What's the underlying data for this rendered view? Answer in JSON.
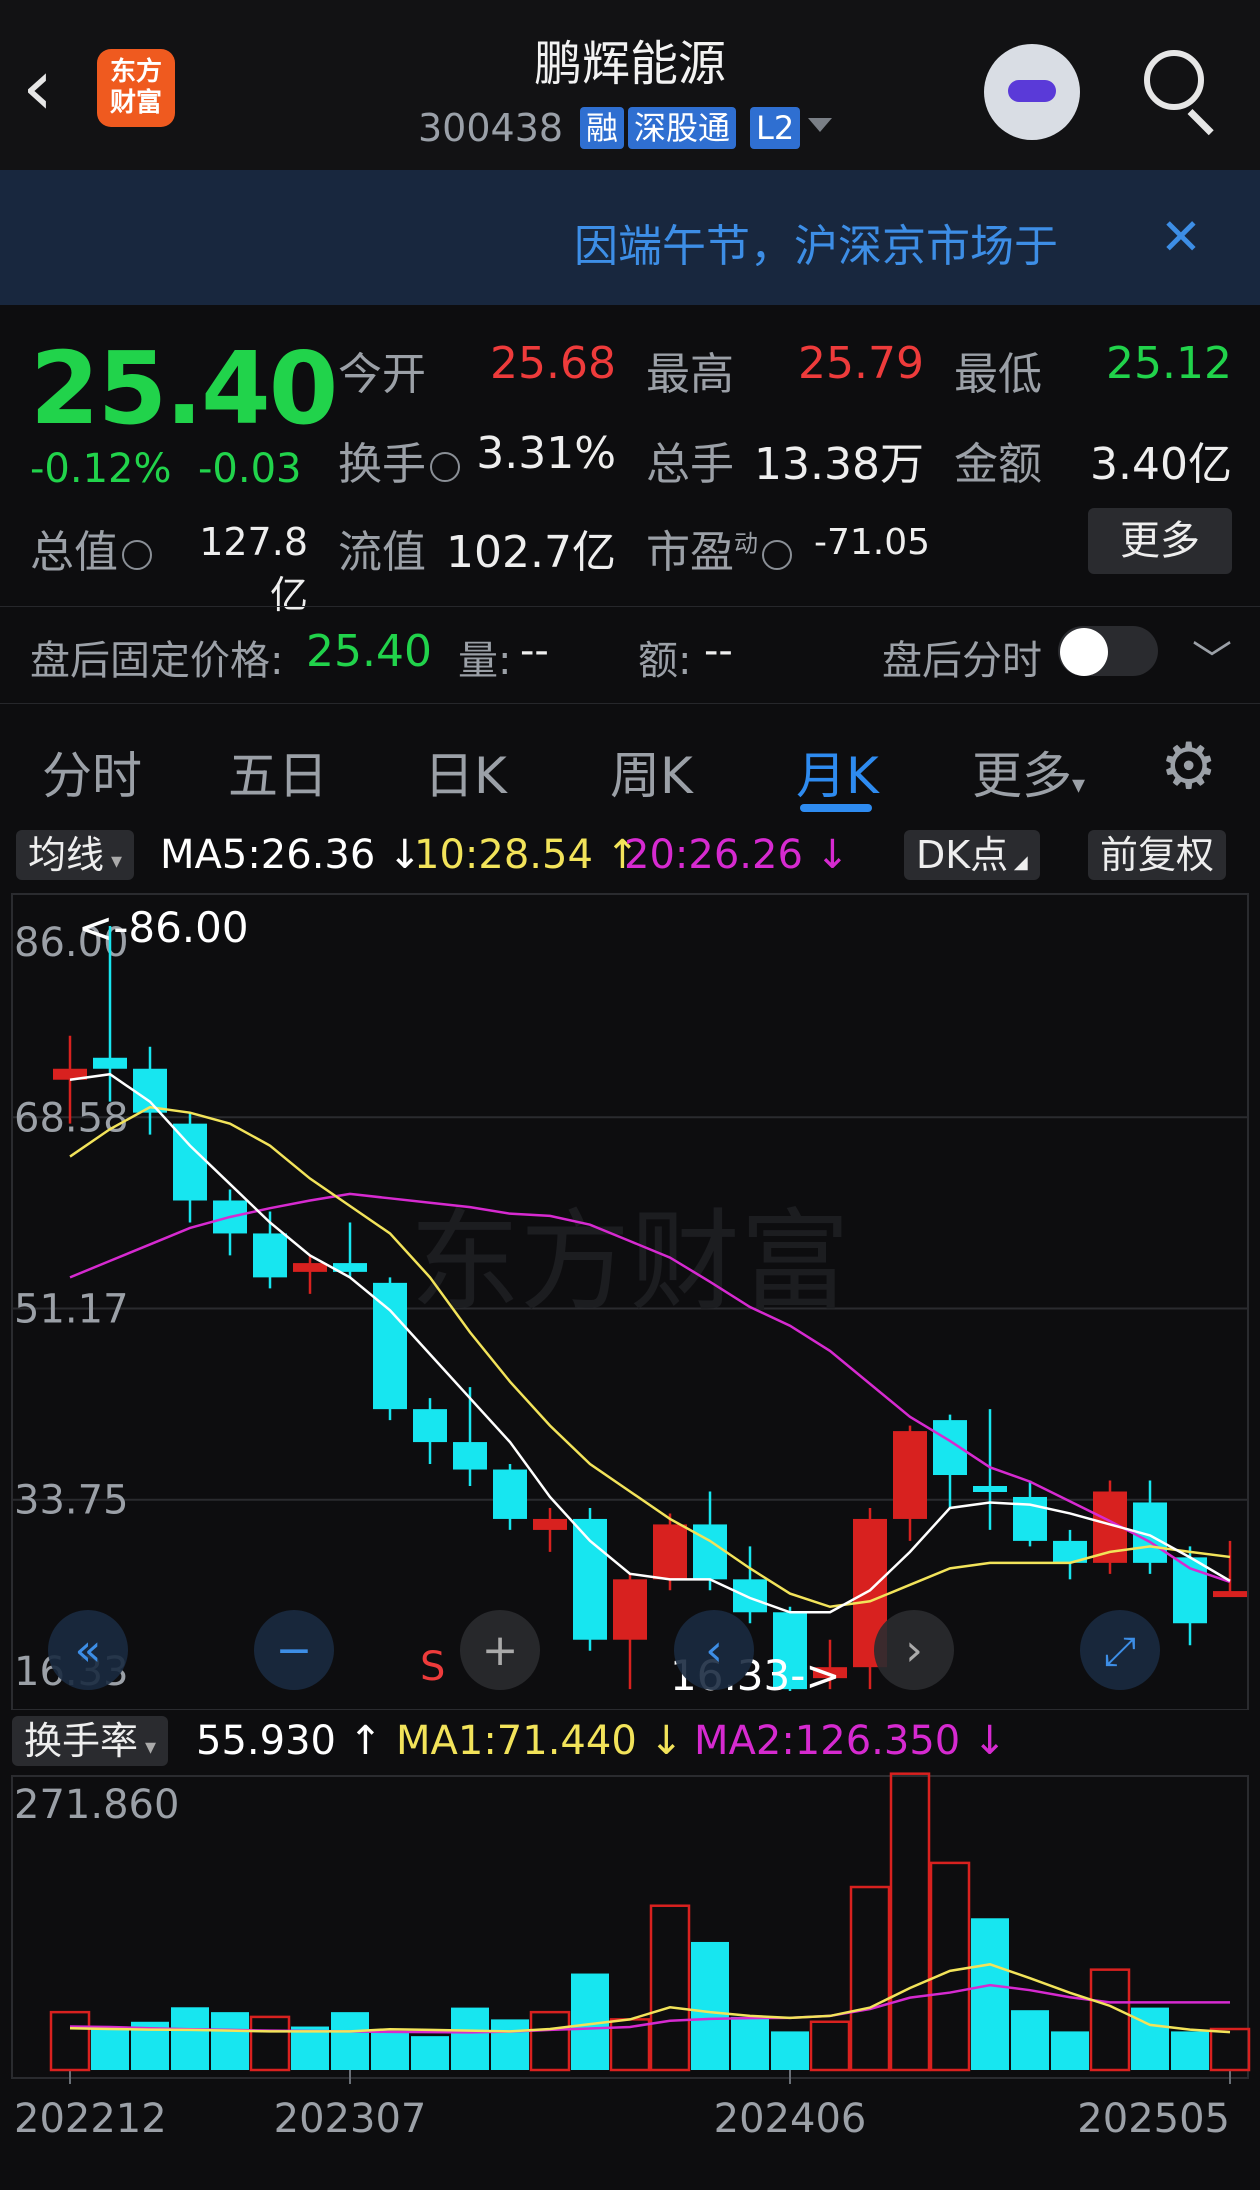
{
  "header": {
    "title": "鹏辉能源",
    "code": "300438",
    "tags": [
      "融",
      "深股通",
      "L2"
    ],
    "logo_text": "东方财富"
  },
  "notice": {
    "text": "因端午节，沪深京市场于"
  },
  "quote": {
    "price": "25.40",
    "change_pct": "-0.12%",
    "change_abs": "-0.03",
    "stats": [
      {
        "label": "今开",
        "value": "25.68"
      },
      {
        "label": "最高",
        "value": "25.79"
      },
      {
        "label": "最低",
        "value": "25.12"
      },
      {
        "label": "换手",
        "value": "3.31%"
      },
      {
        "label": "总手",
        "value": "13.38万"
      },
      {
        "label": "金额",
        "value": "3.40亿"
      },
      {
        "label": "总值",
        "value": "127.8亿"
      },
      {
        "label": "流值",
        "value": "102.7亿"
      },
      {
        "label": "市盈",
        "value": "-71.05",
        "sup": "动"
      }
    ],
    "more_label": "更多"
  },
  "after_hours": {
    "fixed_label": "盘后固定价格:",
    "fixed_value": "25.40",
    "vol_label": "量:",
    "vol_value": "--",
    "amt_label": "额:",
    "amt_value": "--",
    "timeshare_label": "盘后分时"
  },
  "tabs": [
    "分时",
    "五日",
    "日K",
    "周K",
    "月K",
    "更多"
  ],
  "chart_toolbar": {
    "ma_selector": "均线",
    "ma5": "MA5:26.36",
    "ma10": "10:28.54",
    "ma20": "20:26.26",
    "dk": "DK点",
    "adjust": "前复权",
    "colors": {
      "ma5": "#ffffff",
      "ma10": "#f2e35a",
      "ma20": "#d62ad0"
    }
  },
  "volume_toolbar": {
    "selector": "换手率",
    "value": "55.930",
    "ma1": "MA1:71.440",
    "ma2": "MA2:126.350"
  },
  "chart_data": [
    {
      "type": "candlestick",
      "yticks": [
        "86.00",
        "68.58",
        "51.17",
        "33.75",
        "16.33"
      ],
      "ylim": [
        16.33,
        86.0
      ],
      "annotations": {
        "high": "<-86.00",
        "low": "16.33->",
        "signal": "S"
      },
      "watermark": "东方财富",
      "candles": [
        {
          "o": 72,
          "c": 73,
          "h": 76,
          "l": 68
        },
        {
          "o": 74,
          "c": 73,
          "h": 86,
          "l": 70
        },
        {
          "o": 73,
          "c": 69,
          "h": 75,
          "l": 67
        },
        {
          "o": 68,
          "c": 61,
          "h": 69,
          "l": 59
        },
        {
          "o": 61,
          "c": 58,
          "h": 62,
          "l": 56
        },
        {
          "o": 58,
          "c": 54,
          "h": 60,
          "l": 53
        },
        {
          "o": 54.5,
          "c": 55.3,
          "h": 56,
          "l": 52.5
        },
        {
          "o": 55.3,
          "c": 54.5,
          "h": 59,
          "l": 54
        },
        {
          "o": 53.5,
          "c": 42,
          "h": 54,
          "l": 41
        },
        {
          "o": 42,
          "c": 39,
          "h": 43,
          "l": 37
        },
        {
          "o": 39,
          "c": 36.5,
          "h": 44,
          "l": 35
        },
        {
          "o": 36.5,
          "c": 32,
          "h": 37,
          "l": 31
        },
        {
          "o": 31,
          "c": 32,
          "h": 33,
          "l": 29
        },
        {
          "o": 32,
          "c": 21,
          "h": 33,
          "l": 20
        },
        {
          "o": 21,
          "c": 26.5,
          "h": 27,
          "l": 16.5
        },
        {
          "o": 26.5,
          "c": 31.5,
          "h": 32.5,
          "l": 25.5
        },
        {
          "o": 31.5,
          "c": 26.5,
          "h": 34.5,
          "l": 25.5
        },
        {
          "o": 26.5,
          "c": 23.5,
          "h": 29.5,
          "l": 22.5
        },
        {
          "o": 23.5,
          "c": 16.5,
          "h": 24,
          "l": 16.33
        },
        {
          "o": 17.5,
          "c": 18.5,
          "h": 21,
          "l": 16.5
        },
        {
          "o": 18.5,
          "c": 32,
          "h": 33,
          "l": 16.5
        },
        {
          "o": 32,
          "c": 40,
          "h": 40.5,
          "l": 30
        },
        {
          "o": 41,
          "c": 36,
          "h": 41.5,
          "l": 33
        },
        {
          "o": 35,
          "c": 34.5,
          "h": 42,
          "l": 31
        },
        {
          "o": 34,
          "c": 30,
          "h": 35.5,
          "l": 29.5
        },
        {
          "o": 30,
          "c": 28,
          "h": 31,
          "l": 26.5
        },
        {
          "o": 28,
          "c": 34.5,
          "h": 35.5,
          "l": 27
        },
        {
          "o": 33.5,
          "c": 28,
          "h": 35.5,
          "l": 27
        },
        {
          "o": 28.5,
          "c": 22.5,
          "h": 29.5,
          "l": 20.5
        },
        {
          "o": 25.4,
          "c": 25.43,
          "h": 30,
          "l": 25
        }
      ],
      "ma5": [
        72,
        72.5,
        70,
        66,
        62.5,
        59,
        56,
        54,
        51,
        47,
        43,
        39,
        34,
        30,
        27,
        26.5,
        26.5,
        24.8,
        23.5,
        23.5,
        25.5,
        29,
        33,
        33.5,
        33.3,
        32.5,
        31.5,
        30.5,
        28.5,
        26.36
      ],
      "ma10": [
        65,
        67.5,
        69.5,
        69,
        68,
        66,
        63,
        60.5,
        58,
        54,
        49,
        44.5,
        40.5,
        37,
        34.5,
        32,
        30,
        27.5,
        25.2,
        24,
        24.5,
        26,
        27.5,
        28,
        28,
        28,
        29,
        29.5,
        29,
        28.54
      ],
      "ma20": [
        54,
        55.5,
        57,
        58.5,
        59.5,
        60.3,
        61,
        61.6,
        61.2,
        60.8,
        60.4,
        59.8,
        59.6,
        58.8,
        57.3,
        55.8,
        53.6,
        51.3,
        49.6,
        47.3,
        44.3,
        41.3,
        39.1,
        36.7,
        35.4,
        33.6,
        31.8,
        29.9,
        27.5,
        26.26
      ]
    },
    {
      "type": "bar",
      "title": "换手率",
      "yticks": [
        "271.860"
      ],
      "ylim": [
        0,
        271.86
      ],
      "xticks": [
        "202212",
        "202307",
        "202406",
        "202505"
      ],
      "values": [
        53.5,
        40.2,
        44.6,
        58,
        53.5,
        49.1,
        40.2,
        53.5,
        35.7,
        31.3,
        57.7,
        46.8,
        53.5,
        89.2,
        46.8,
        151.9,
        118.4,
        49.1,
        35.7,
        44.6,
        169.2,
        274,
        191.5,
        140.3,
        55.3,
        35.7,
        92.8,
        57.7,
        35.7,
        37.9
      ],
      "rising": [
        true,
        false,
        false,
        false,
        false,
        true,
        false,
        false,
        false,
        false,
        false,
        false,
        true,
        false,
        true,
        true,
        false,
        false,
        false,
        true,
        true,
        true,
        true,
        false,
        false,
        false,
        true,
        false,
        false,
        true
      ],
      "ma1": [
        38.6,
        37.9,
        37.3,
        37.1,
        36.4,
        35.7,
        35.7,
        35.7,
        37.7,
        37.1,
        36.4,
        35.7,
        37.9,
        42.4,
        46.8,
        58,
        53.5,
        50,
        48.2,
        50,
        57.7,
        75.8,
        91.7,
        97.7,
        84.9,
        71.4,
        59.3,
        41.7,
        37.3,
        35
      ],
      "ma2": [
        40.2,
        39.8,
        38.6,
        37.7,
        37.1,
        36.4,
        36.1,
        35.7,
        35.2,
        35.0,
        34.8,
        35.5,
        37.1,
        38.4,
        39.8,
        45.5,
        47.3,
        48.0,
        48.2,
        50.0,
        56.4,
        66.9,
        71.6,
        78.5,
        73.8,
        67.3,
        62.5,
        62.5,
        62.5,
        62.5
      ]
    }
  ]
}
